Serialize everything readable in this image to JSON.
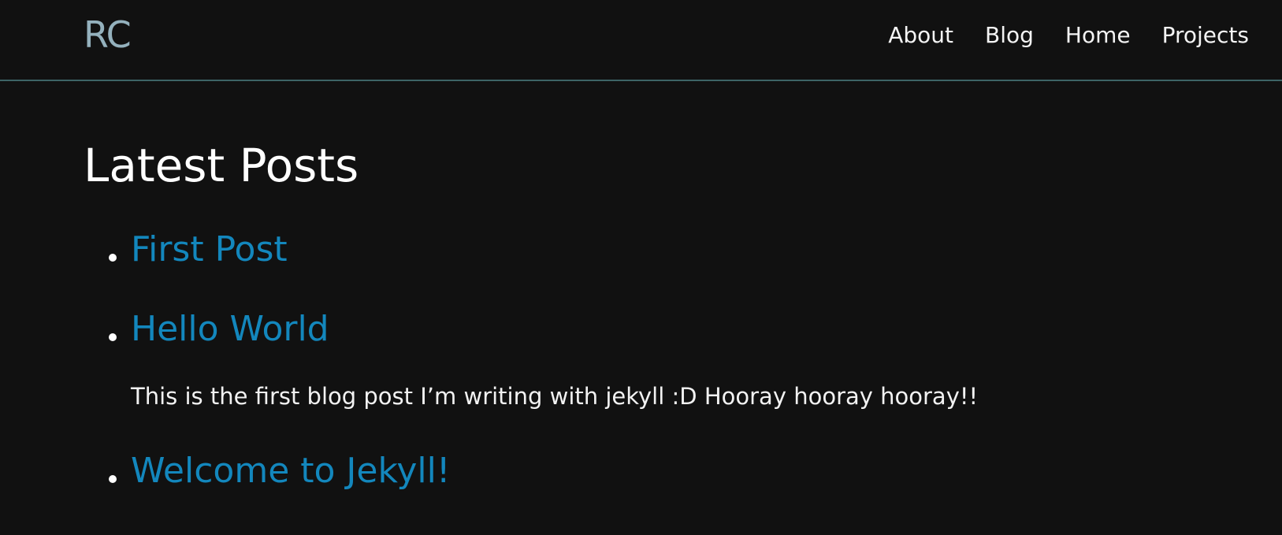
{
  "header": {
    "logo": "RC",
    "nav": [
      "About",
      "Blog",
      "Home",
      "Projects"
    ]
  },
  "main": {
    "title": "Latest Posts",
    "posts": [
      {
        "title": "First Post",
        "excerpt": ""
      },
      {
        "title": "Hello World",
        "excerpt": "This is the first blog post I’m writing with jekyll :D Hooray hooray hooray!!"
      },
      {
        "title": "Welcome to Jekyll!",
        "excerpt": ""
      }
    ]
  },
  "colors": {
    "background": "#111111",
    "logo": "#94b1bd",
    "link": "#1387bd",
    "header_border": "#3d6466",
    "text": "#ffffff"
  }
}
